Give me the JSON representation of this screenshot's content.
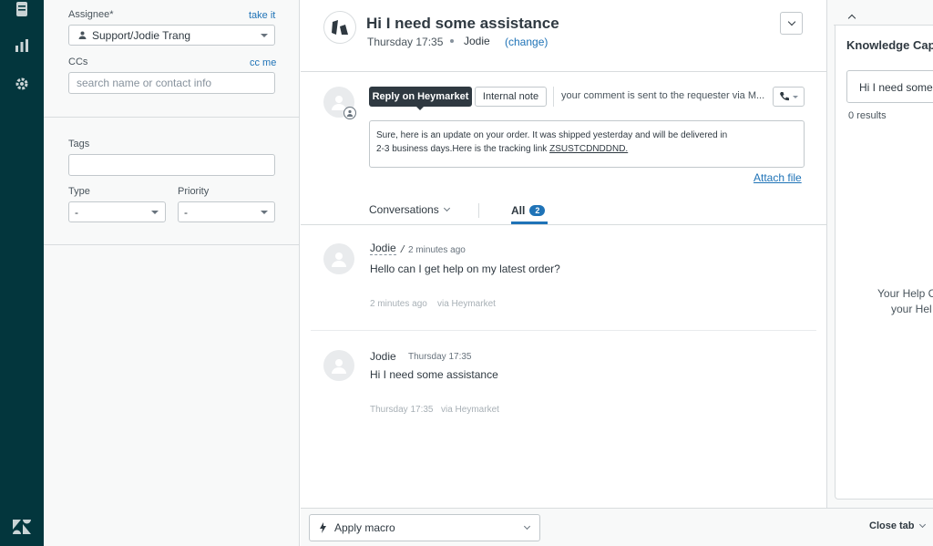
{
  "rail": {
    "icons": [
      "views-icon",
      "reporting-icon",
      "admin-gear-icon",
      "zendesk-logo-icon"
    ]
  },
  "props": {
    "assignee_label": "Assignee*",
    "take_it": "take it",
    "assignee_value": "Support/Jodie Trang",
    "ccs_label": "CCs",
    "cc_me": "cc me",
    "ccs_placeholder": "search name or contact info",
    "tags_label": "Tags",
    "type_label": "Type",
    "type_value": "-",
    "priority_label": "Priority",
    "priority_value": "-"
  },
  "ticket": {
    "title": "Hi I need some assistance",
    "time": "Thursday 17:35",
    "requester": "Jodie",
    "change": "(change)"
  },
  "composer": {
    "tooltip": "Reply on Heymarket",
    "internal_note": "Internal note",
    "notice": "your comment is sent to the requester via M...",
    "body_line1": "Sure, here is an update on your order. It was shipped yesterday and will be delivered in",
    "body_line2": "2-3 business days.Here is the tracking link ",
    "tracking_link": "ZSUSTCDNDDND.",
    "attach_file": "Attach file"
  },
  "filters": {
    "conversations": "Conversations",
    "all": "All",
    "all_count": "2"
  },
  "messages": [
    {
      "author": "Jodie",
      "time": "2 minutes ago",
      "text": "Hello can I get help on my latest order?",
      "meta_time": "2 minutes ago",
      "via": "via Heymarket"
    },
    {
      "author": "Jodie",
      "time": "Thursday 17:35",
      "text": "Hi I need some assistance",
      "meta_time": "Thursday 17:35",
      "via": "via Heymarket"
    }
  ],
  "bottom": {
    "apply_macro": "Apply macro",
    "close_tab": "Close tab"
  },
  "knowledge": {
    "title": "Knowledge Cap",
    "search_value": "Hi I need some",
    "results": "0 results",
    "help_line1": "Your Help C",
    "help_line2": "your Hel"
  },
  "colors": {
    "rail": "#03363d",
    "link": "#1f73b7",
    "tooltip": "#2f3941",
    "badge": "#1f73b7"
  }
}
